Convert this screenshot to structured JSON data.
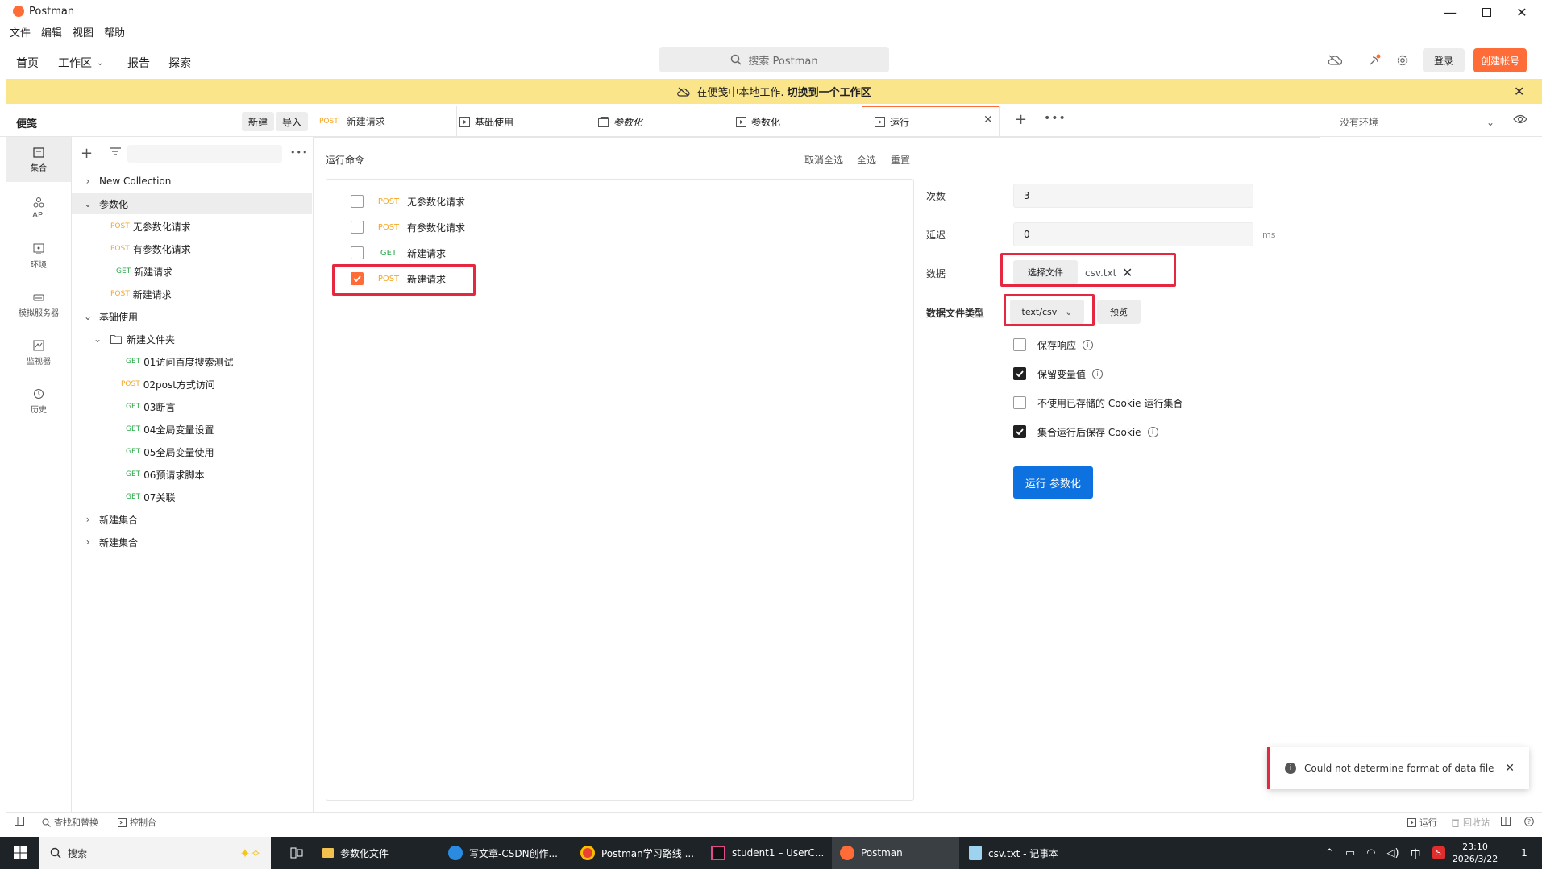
{
  "app": {
    "title": "Postman"
  },
  "menu": [
    "文件",
    "编辑",
    "视图",
    "帮助"
  ],
  "header": {
    "nav": [
      "首页",
      "工作区",
      "报告",
      "探索"
    ],
    "search_placeholder": "搜索 Postman",
    "signin": "登录",
    "create_account": "创建帐号"
  },
  "banner": {
    "text": "在便笺中本地工作.",
    "link": "切换到一个工作区"
  },
  "sidebar": {
    "title": "便笺",
    "new_btn": "新建",
    "import_btn": "导入",
    "rail": [
      "集合",
      "API",
      "环境",
      "模拟服务器",
      "监视器",
      "历史"
    ],
    "tree": [
      {
        "label": "New Collection",
        "method": ""
      },
      {
        "label": "参数化",
        "method": ""
      },
      {
        "label": "无参数化请求",
        "method": "POST"
      },
      {
        "label": "有参数化请求",
        "method": "POST"
      },
      {
        "label": "新建请求",
        "method": "GET"
      },
      {
        "label": "新建请求",
        "method": "POST"
      },
      {
        "label": "基础使用",
        "method": ""
      },
      {
        "label": "新建文件夹",
        "method": ""
      },
      {
        "label": "01访问百度搜索测试",
        "method": "GET"
      },
      {
        "label": "02post方式访问",
        "method": "POST"
      },
      {
        "label": "03断言",
        "method": "GET"
      },
      {
        "label": "04全局变量设置",
        "method": "GET"
      },
      {
        "label": "05全局变量使用",
        "method": "GET"
      },
      {
        "label": "06预请求脚本",
        "method": "GET"
      },
      {
        "label": "07关联",
        "method": "GET"
      },
      {
        "label": "新建集合",
        "method": ""
      },
      {
        "label": "新建集合",
        "method": ""
      }
    ]
  },
  "tabs": [
    {
      "method": "POST",
      "label": "新建请求"
    },
    {
      "method": "",
      "label": "基础使用"
    },
    {
      "method": "",
      "label": "参数化"
    },
    {
      "method": "",
      "label": "参数化"
    },
    {
      "method": "",
      "label": "运行"
    }
  ],
  "environment": {
    "selected": "没有环境"
  },
  "runner": {
    "order_title": "运行命令",
    "deselect_all": "取消全选",
    "select_all": "全选",
    "reset": "重置",
    "requests": [
      {
        "method": "POST",
        "label": "无参数化请求",
        "checked": false
      },
      {
        "method": "POST",
        "label": "有参数化请求",
        "checked": false
      },
      {
        "method": "GET",
        "label": "新建请求",
        "checked": false
      },
      {
        "method": "POST",
        "label": "新建请求",
        "checked": true
      }
    ],
    "iterations_label": "次数",
    "iterations_value": "3",
    "delay_label": "延迟",
    "delay_value": "0",
    "delay_unit": "ms",
    "data_label": "数据",
    "select_file": "选择文件",
    "file_name": "csv.txt",
    "data_type_label": "数据文件类型",
    "data_type_value": "text/csv",
    "preview": "预览",
    "options": [
      {
        "label": "保存响应",
        "checked": false,
        "info": true
      },
      {
        "label": "保留变量值",
        "checked": true,
        "info": true
      },
      {
        "label": "不使用已存储的 Cookie 运行集合",
        "checked": false,
        "info": false
      },
      {
        "label": "集合运行后保存 Cookie",
        "checked": true,
        "info": true
      }
    ],
    "run_button": "运行 参数化"
  },
  "toast": {
    "message": "Could not determine format of data file"
  },
  "statusbar": {
    "find_replace": "查找和替换",
    "console": "控制台",
    "runner": "运行",
    "trash": "回收站"
  },
  "taskbar": {
    "search": "搜索",
    "apps": [
      "参数化文件",
      "写文章-CSDN创作...",
      "Postman学习路线 ...",
      "student1 – UserC...",
      "Postman",
      "csv.txt - 记事本"
    ],
    "time": "23:10",
    "date": "2026/3/22",
    "ime": "中",
    "notifications": "1"
  },
  "colors": {
    "brand": "#ff6c37",
    "primary": "#0d72e0",
    "highlight": "#e5283f",
    "banner": "#fbe58a",
    "post": "#f5a623",
    "get": "#2aa84a"
  }
}
